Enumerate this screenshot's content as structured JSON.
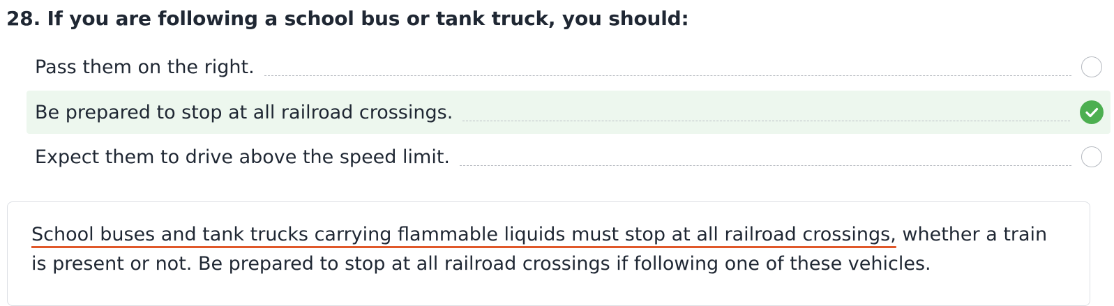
{
  "question": {
    "title": "28. If you are following a school bus or tank truck, you should:"
  },
  "options": [
    {
      "label": "Pass them on the right.",
      "state": "unselected"
    },
    {
      "label": "Be prepared to stop at all railroad crossings.",
      "state": "correct"
    },
    {
      "label": "Expect them to drive above the speed limit.",
      "state": "unselected"
    }
  ],
  "explanation": {
    "highlighted": "School buses and tank trucks carrying flammable liquids must stop at all railroad crossings,",
    "rest": " whether a train is present or not. Be prepared to stop at all railroad crossings if following one of these vehicles."
  },
  "colors": {
    "correct_bg": "#edf7ee",
    "check_green": "#4caf50",
    "underline_accent": "#e0582a"
  },
  "icons": {
    "correct": "check-circle-icon",
    "unselected": "empty-radio-icon"
  }
}
